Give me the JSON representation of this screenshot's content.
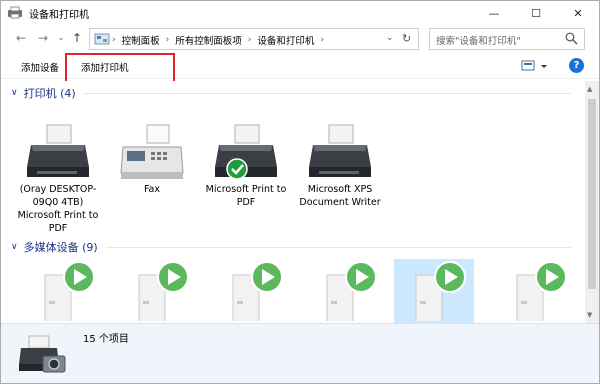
{
  "window": {
    "title": "设备和打印机",
    "controls": {
      "minimize": "—",
      "maximize": "☐",
      "close": "✕"
    }
  },
  "nav": {
    "back": "←",
    "forward": "→",
    "recent": "⌄",
    "up": "↑"
  },
  "address": {
    "separator": "›",
    "crumbs": [
      "控制面板",
      "所有控制面板项",
      "设备和打印机"
    ],
    "dropdown": "⌄",
    "refresh": "↻"
  },
  "search": {
    "placeholder": "搜索\"设备和打印机\""
  },
  "toolbar": {
    "add_device": "添加设备",
    "add_printer": "添加打印机",
    "help": "?"
  },
  "groups": {
    "printers": {
      "chevron": "∨",
      "title": "打印机 (4)"
    },
    "multimedia": {
      "chevron": "∨",
      "title": "多媒体设备 (9)"
    }
  },
  "printers": [
    {
      "label": "(Oray DESKTOP-09Q0 4TB) Microsoft Print to PDF",
      "icon": "printer-icon"
    },
    {
      "label": "Fax",
      "icon": "fax-icon"
    },
    {
      "label": "Microsoft Print to PDF",
      "icon": "printer-default-icon"
    },
    {
      "label": "Microsoft XPS Document Writer",
      "icon": "printer-icon"
    }
  ],
  "media_devices": [
    {
      "icon": "media-device-icon"
    },
    {
      "icon": "media-device-icon"
    },
    {
      "icon": "media-device-icon"
    },
    {
      "icon": "media-device-icon"
    },
    {
      "icon": "media-device-icon",
      "selected": true
    },
    {
      "icon": "media-device-icon"
    }
  ],
  "status": {
    "item_count": "15 个项目"
  },
  "colors": {
    "group_title": "#1e3287",
    "highlight_box": "#e0242b",
    "selection": "#cce8ff",
    "play_green": "#5cb85c",
    "help_blue": "#1c6fd4"
  }
}
